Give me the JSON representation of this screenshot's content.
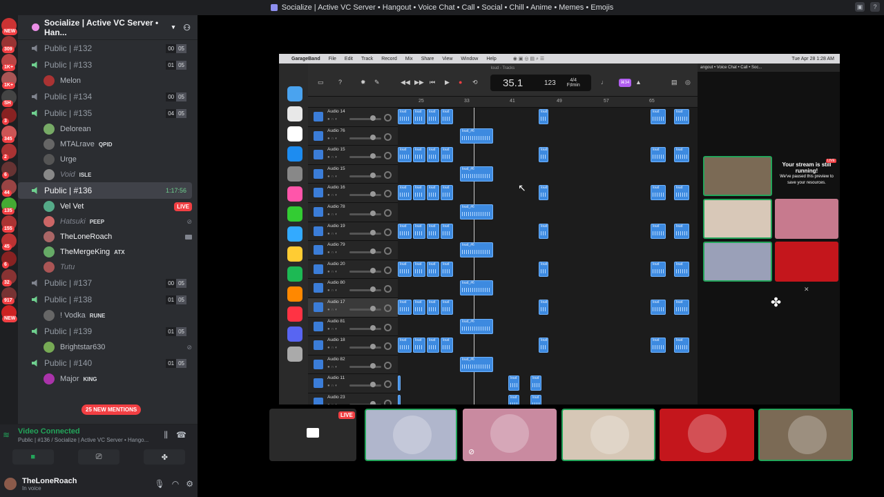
{
  "window": {
    "title": "Socialize | Active VC Server • Hangout • Voice Chat • Call • Social • Chill • Anime • Memes • Emojis"
  },
  "server_rail": {
    "badges": [
      "NEW",
      "309",
      "1K+",
      "1K+",
      "SH",
      "3",
      "345",
      "2",
      "6",
      "44",
      "135",
      "155",
      "45",
      "6",
      "32",
      "917",
      "NEW"
    ]
  },
  "server": {
    "name": "Socialize | Active VC Server • Han..."
  },
  "channels": [
    {
      "name": "Public | #132",
      "count": "00",
      "limit": "05",
      "users": []
    },
    {
      "name": "Public | #133",
      "count": "01",
      "limit": "05",
      "users": [
        {
          "name": "Melon",
          "tag": ""
        }
      ]
    },
    {
      "name": "Public | #134",
      "count": "00",
      "limit": "05",
      "users": []
    },
    {
      "name": "Public | #135",
      "count": "04",
      "limit": "05",
      "users": [
        {
          "name": "Delorean",
          "tag": ""
        },
        {
          "name": "MTALrave",
          "tag": "QPID"
        },
        {
          "name": "Urge",
          "tag": ""
        },
        {
          "name": "Void",
          "tag": "ISLE"
        }
      ]
    },
    {
      "name": "Public | #136",
      "time": "1:17:56",
      "users": [
        {
          "name": "Vel Vet",
          "tag": "",
          "live": "LIVE"
        },
        {
          "name": "Hatsuki",
          "tag": "PEEP"
        },
        {
          "name": "TheLoneRoach",
          "tag": ""
        },
        {
          "name": "TheMergeKing",
          "tag": "ATX"
        },
        {
          "name": "Tutu",
          "tag": ""
        }
      ]
    },
    {
      "name": "Public | #137",
      "count": "00",
      "limit": "05",
      "users": []
    },
    {
      "name": "Public | #138",
      "count": "01",
      "limit": "05",
      "users": [
        {
          "name": "! Vodka",
          "tag": "RUNE"
        }
      ]
    },
    {
      "name": "Public | #139",
      "count": "01",
      "limit": "05",
      "users": [
        {
          "name": "Brightstar630",
          "tag": ""
        }
      ]
    },
    {
      "name": "Public | #140",
      "count": "01",
      "limit": "05",
      "users": [
        {
          "name": "Major",
          "tag": "KING"
        }
      ]
    }
  ],
  "mentions": "25 NEW MENTIONS",
  "voice": {
    "status": "Video Connected",
    "location": "Public | #136 / Socialize | Active VC Server • Hango..."
  },
  "user": {
    "name": "TheLoneRoach",
    "status": "In voice"
  },
  "stream": {
    "menubar": [
      "GarageBand",
      "File",
      "Edit",
      "Track",
      "Record",
      "Mix",
      "Share",
      "View",
      "Window",
      "Help"
    ],
    "clock": "Tue Apr 28  1:28 AM",
    "window_title": "loud - Tracks",
    "lcd": {
      "bar": "35.1",
      "tempo": "123",
      "sig_top": "4/4",
      "key": "F♯min"
    },
    "purple_btn": "⌘34",
    "ruler": [
      "25",
      "33",
      "41",
      "49",
      "57",
      "65"
    ],
    "tracks": [
      "Audio 14",
      "Audio 76",
      "Audio 15",
      "Audio 15",
      "Audio 16",
      "Audio 78",
      "Audio 19",
      "Audio 79",
      "Audio 20",
      "Audio 80",
      "Audio 17",
      "Audio 81",
      "Audio 18",
      "Audio 82",
      "Audio 11",
      "Audio 23"
    ],
    "clip_label": "loud",
    "clip_label2": "loud_#6",
    "right_title": "angout • Voice Chat • Call • Soc...",
    "paused_title": "Your stream is still running!",
    "paused_sub": "We've paused this preview to save your resources.",
    "live_small": "LIVE"
  },
  "bottom_live": "LIVE"
}
